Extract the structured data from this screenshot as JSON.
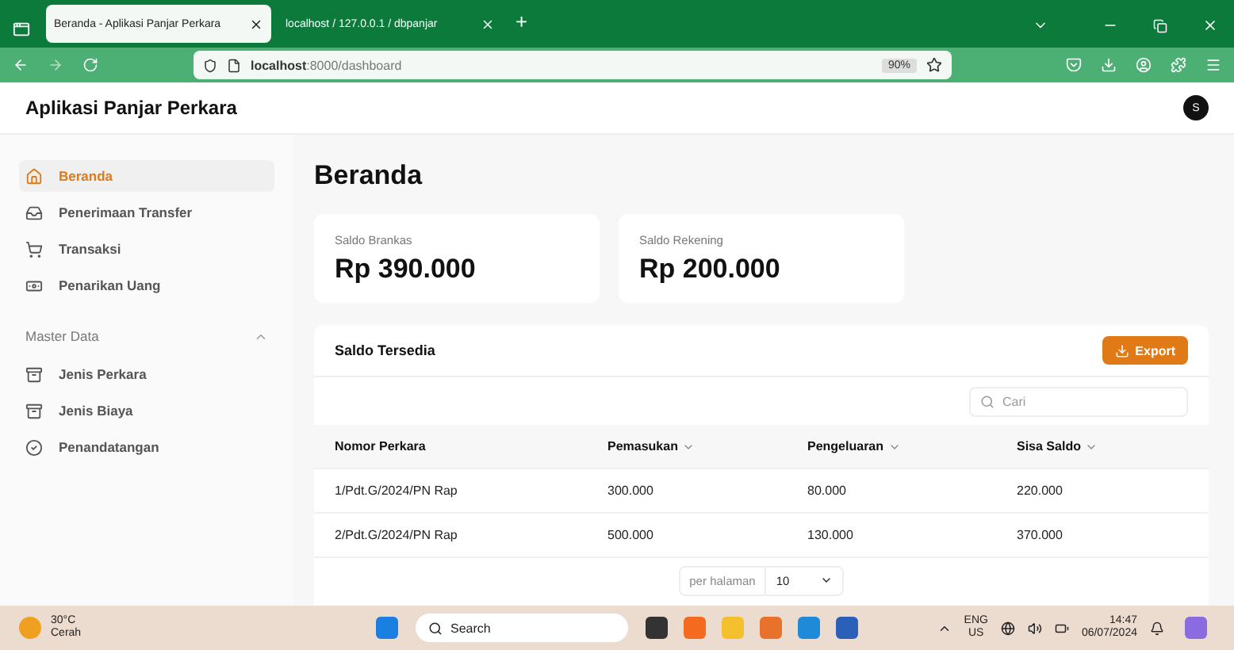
{
  "browser": {
    "tabs": [
      {
        "title": "Beranda - Aplikasi Panjar Perkara",
        "selected": true
      },
      {
        "title": "localhost / 127.0.0.1 / dbpanjar",
        "selected": false
      }
    ],
    "new_tab": "+",
    "url_host": "localhost",
    "url_path": ":8000/dashboard",
    "zoom": "90%"
  },
  "app": {
    "title": "Aplikasi Panjar Perkara",
    "avatar": "S"
  },
  "sidebar": {
    "items": [
      {
        "label": "Beranda",
        "selected": true
      },
      {
        "label": "Penerimaan Transfer",
        "selected": false
      },
      {
        "label": "Transaksi",
        "selected": false
      },
      {
        "label": "Penarikan Uang",
        "selected": false
      }
    ],
    "section": {
      "title": "Master Data",
      "expanded": true,
      "items": [
        {
          "label": "Jenis Perkara",
          "selected": false
        },
        {
          "label": "Jenis Biaya",
          "selected": false
        },
        {
          "label": "Penandatangan",
          "selected": false
        }
      ]
    }
  },
  "page": {
    "heading": "Beranda",
    "cards": [
      {
        "label": "Saldo Brankas",
        "value": "Rp 390.000"
      },
      {
        "label": "Saldo Rekening",
        "value": "Rp 200.000"
      }
    ],
    "table": {
      "title": "Saldo Tersedia",
      "export": "Export",
      "search_placeholder": "Cari",
      "columns": [
        {
          "label": "Nomor Perkara",
          "sortable": false
        },
        {
          "label": "Pemasukan",
          "sortable": true
        },
        {
          "label": "Pengeluaran",
          "sortable": true
        },
        {
          "label": "Sisa Saldo",
          "sortable": true
        }
      ],
      "rows": [
        [
          "1/Pdt.G/2024/PN Rap",
          "300.000",
          "80.000",
          "220.000"
        ],
        [
          "2/Pdt.G/2024/PN Rap",
          "500.000",
          "130.000",
          "370.000"
        ]
      ],
      "pagination": {
        "label": "per halaman",
        "value": "10"
      }
    }
  },
  "taskbar": {
    "temperature": "30°C",
    "condition": "Cerah",
    "search": "Search",
    "language": "ENG",
    "region": "US",
    "time": "14:47",
    "date": "06/07/2024"
  }
}
